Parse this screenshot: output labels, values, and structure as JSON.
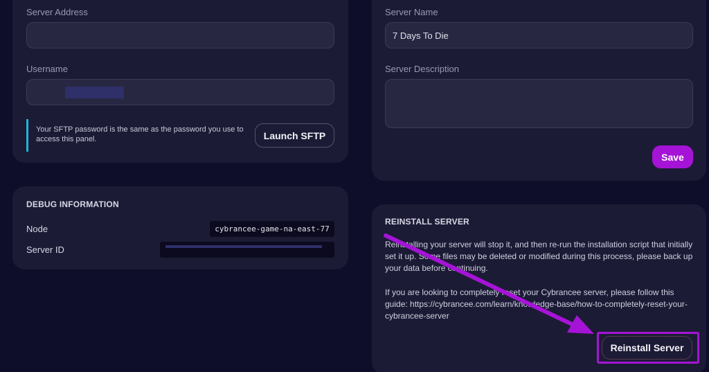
{
  "sftp": {
    "server_address_label": "Server Address",
    "server_address_value": "",
    "username_label": "Username",
    "username_value": "",
    "note_text": "Your SFTP password is the same as the password you use to access this panel.",
    "launch_label": "Launch SFTP"
  },
  "debug": {
    "title": "DEBUG INFORMATION",
    "node_label": "Node",
    "node_value": "cybrancee-game-na-east-77",
    "server_id_label": "Server ID",
    "server_id_value": ""
  },
  "server": {
    "name_label": "Server Name",
    "name_value": "7 Days To Die",
    "description_label": "Server Description",
    "description_value": "",
    "save_label": "Save"
  },
  "reinstall": {
    "title": "REINSTALL SERVER",
    "paragraph1": "Reinstalling your server will stop it, and then re-run the installation script that initially set it up. Some files may be deleted or modified during this process, please back up your data before continuing.",
    "paragraph2": "If you are looking to completely reset your Cybrancee server, please follow this guide: https://cybrancee.com/learn/knowledge-base/how-to-completely-reset-your-cybrancee-server",
    "button_label": "Reinstall Server"
  },
  "colors": {
    "background": "#0f0e2a",
    "card": "#1c1b35",
    "accent": "#a514d6",
    "note_border": "#1fb6d6"
  }
}
